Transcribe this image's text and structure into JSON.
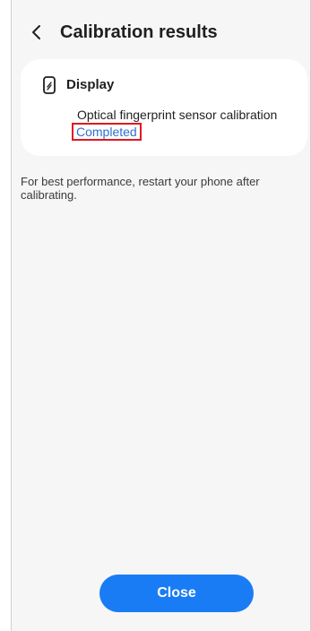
{
  "header": {
    "title": "Calibration results",
    "back_icon": "chevron-left-icon"
  },
  "card": {
    "icon": "phone-display-icon",
    "title": "Display",
    "item_label": "Optical fingerprint sensor calibration",
    "item_status": "Completed"
  },
  "note": "For best performance, restart your phone after calibrating.",
  "footer": {
    "close_label": "Close"
  },
  "colors": {
    "accent": "#1a7cf5",
    "status_text": "#2f6fcf",
    "highlight_border": "#e0191f",
    "background": "#f6f6f6"
  }
}
